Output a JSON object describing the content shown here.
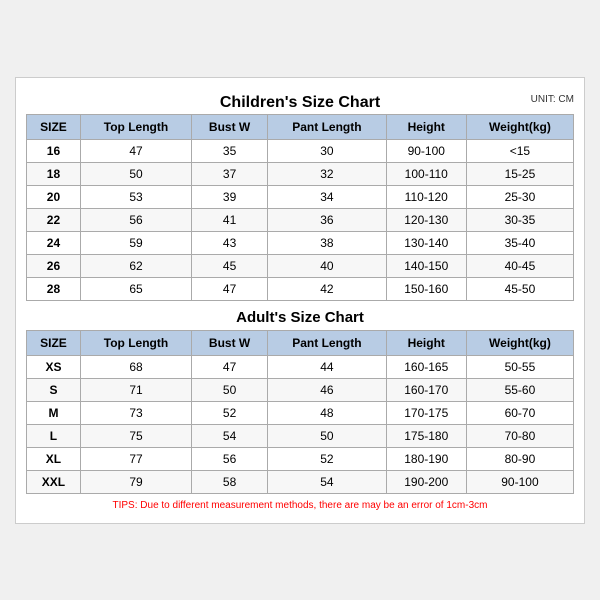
{
  "children_chart": {
    "title": "Children's Size Chart",
    "unit": "UNIT: CM",
    "headers": [
      "SIZE",
      "Top Length",
      "Bust W",
      "Pant Length",
      "Height",
      "Weight(kg)"
    ],
    "rows": [
      [
        "16",
        "47",
        "35",
        "30",
        "90-100",
        "<15"
      ],
      [
        "18",
        "50",
        "37",
        "32",
        "100-110",
        "15-25"
      ],
      [
        "20",
        "53",
        "39",
        "34",
        "110-120",
        "25-30"
      ],
      [
        "22",
        "56",
        "41",
        "36",
        "120-130",
        "30-35"
      ],
      [
        "24",
        "59",
        "43",
        "38",
        "130-140",
        "35-40"
      ],
      [
        "26",
        "62",
        "45",
        "40",
        "140-150",
        "40-45"
      ],
      [
        "28",
        "65",
        "47",
        "42",
        "150-160",
        "45-50"
      ]
    ]
  },
  "adult_chart": {
    "title": "Adult's Size Chart",
    "headers": [
      "SIZE",
      "Top Length",
      "Bust W",
      "Pant Length",
      "Height",
      "Weight(kg)"
    ],
    "rows": [
      [
        "XS",
        "68",
        "47",
        "44",
        "160-165",
        "50-55"
      ],
      [
        "S",
        "71",
        "50",
        "46",
        "160-170",
        "55-60"
      ],
      [
        "M",
        "73",
        "52",
        "48",
        "170-175",
        "60-70"
      ],
      [
        "L",
        "75",
        "54",
        "50",
        "175-180",
        "70-80"
      ],
      [
        "XL",
        "77",
        "56",
        "52",
        "180-190",
        "80-90"
      ],
      [
        "XXL",
        "79",
        "58",
        "54",
        "190-200",
        "90-100"
      ]
    ]
  },
  "tips": "TIPS: Due to different measurement methods, there are may be an error of 1cm-3cm"
}
